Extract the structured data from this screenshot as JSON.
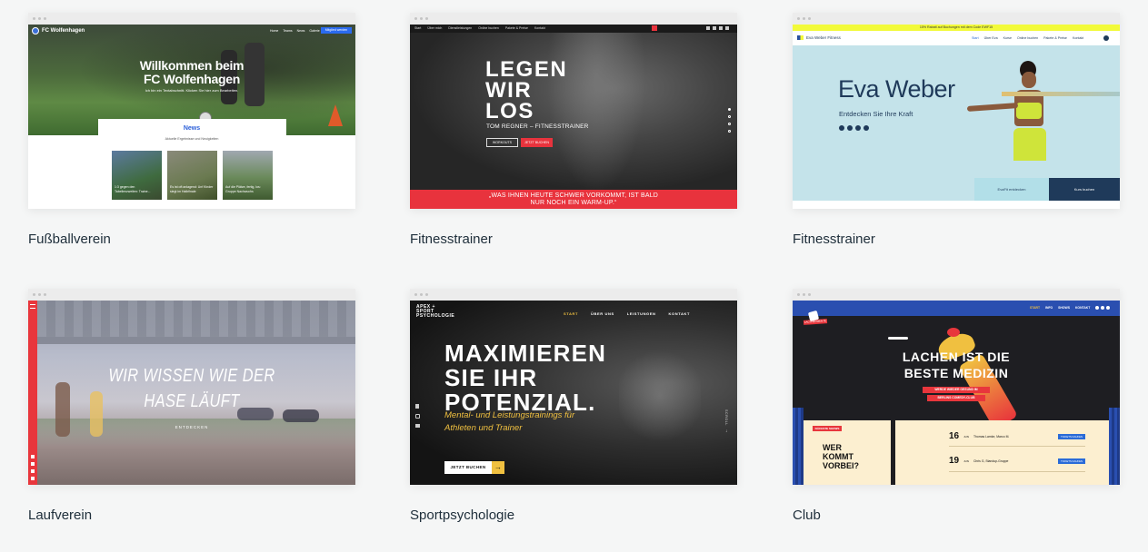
{
  "cards": [
    {
      "label": "Fußballverein",
      "preview": {
        "logo": "FC Wolfenhagen",
        "nav": [
          "Home",
          "Teams",
          "News",
          "Galerie"
        ],
        "cta": "Mitglied werden",
        "hero_title_1": "Willkommen beim",
        "hero_title_2": "FC Wolfenhagen",
        "hero_sub": "Ich bin ein Textabschnitt. Klicken Sie hier zum Bearbeiten.",
        "news_title": "News",
        "news_sub": "Aktuelle Ergebnisse und Neuigkeiten",
        "news_items": [
          "1:3 gegen den Tabellenzweiten: Traine...",
          "Es ist oft anlagend: Unf Kinder siegt im Halbfinale",
          "Auf die Plätze, fertig, los: Gruppe Nachwuchs"
        ]
      }
    },
    {
      "label": "Fitnesstrainer",
      "preview": {
        "nav": [
          "Start",
          "Über mich",
          "Dienstleistungen",
          "Online buchen",
          "Pakete & Preise",
          "Kontakt"
        ],
        "title_1": "LEGEN",
        "title_2": "WIR",
        "title_3": "LOS",
        "subtitle": "TOM REGNER – FITNESSTRAINER",
        "btn_1": "WORKOUTS",
        "btn_2": "JETZT BUCHEN",
        "quote_1": "„WAS IHNEN HEUTE SCHWER VORKOMMT, IST BALD",
        "quote_2": "NUR NOCH EIN WARM-UP.“",
        "accent": "#e8333d"
      }
    },
    {
      "label": "Fitnesstrainer",
      "preview": {
        "banner": "15% Rabatt auf Buchungen mit dem Code EWF15",
        "logo": "Eva Weber Fitness",
        "nav": [
          "Start",
          "Über Eva",
          "Kurse",
          "Online buchen",
          "Pakete & Preise",
          "Kontakt"
        ],
        "title": "Eva Weber",
        "subtitle": "Entdecken Sie Ihre Kraft",
        "btn_1": "EvaFit entdecken",
        "btn_2": "Kurs buchen",
        "accent": "#f2fa3a"
      }
    },
    {
      "label": "Laufverein",
      "preview": {
        "title_1": "WIR WISSEN WIE DER",
        "title_2": "HASE LÄUFT",
        "sub": "ENTDECKEN",
        "accent": "#e8363c"
      }
    },
    {
      "label": "Sportpsychologie",
      "preview": {
        "logo_1": "APEX +",
        "logo_2": "SPORT",
        "logo_3": "PSYCHOLOGIE",
        "nav": [
          "START",
          "ÜBER UNS",
          "LEISTUNGEN",
          "KONTAKT"
        ],
        "title_1": "MAXIMIEREN",
        "title_2": "SIE IHR",
        "title_3": "POTENZIAL.",
        "sub_1": "Mental- und Leistungstrainings für",
        "sub_2": "Athleten und Trainer",
        "btn": "JETZT BUCHEN",
        "scroll": "SCROLL",
        "accent": "#f0c040"
      }
    },
    {
      "label": "Club",
      "preview": {
        "nav": [
          "START",
          "INFO",
          "SHOWS",
          "KONTAKT"
        ],
        "badge": "LACH-MOMENTE",
        "title_1": "LACHEN IST DIE",
        "title_2": "BESTE MEDIZIN",
        "tag_1": "WERDE WIEDER GESUND IM",
        "tag_2": "BERLINS COMEDY-CLUB",
        "shows_tag": "NÄCHSTE SHOWS",
        "question_1": "WER",
        "question_2": "KOMMT",
        "question_3": "VORBEI?",
        "events": [
          {
            "day": "16",
            "month": "JUN",
            "name": "Thomas Lamke, Marco M.",
            "btn": "TICKETS KAUFEN"
          },
          {
            "day": "19",
            "month": "JUN",
            "name": "Chris G, Standup-Gruppe",
            "btn": "TICKETS KAUFEN"
          }
        ],
        "accent": "#2a4fb0"
      }
    }
  ]
}
